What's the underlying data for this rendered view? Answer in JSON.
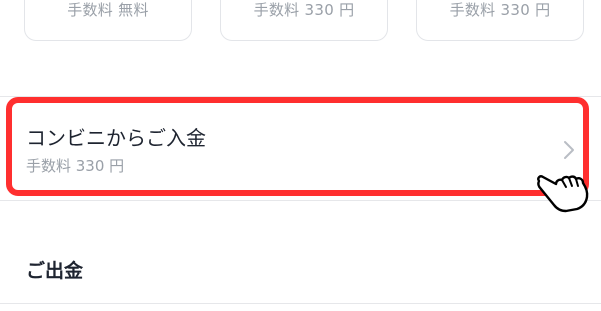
{
  "payment_options": [
    {
      "fee": "手数料 無料"
    },
    {
      "fee": "手数料 330 円"
    },
    {
      "fee": "手数料 330 円"
    }
  ],
  "convenience_deposit": {
    "title": "コンビニからご入金",
    "fee": "手数料 330 円"
  },
  "withdraw_section": {
    "title": "ご出金"
  },
  "colors": {
    "highlight": "#ff2f2f",
    "text_primary": "#1e2430",
    "text_secondary": "#9aa0a8",
    "divider": "#e6e7ea"
  },
  "icons": {
    "chevron": "chevron-right-icon",
    "cursor": "hand-pointer-icon"
  }
}
